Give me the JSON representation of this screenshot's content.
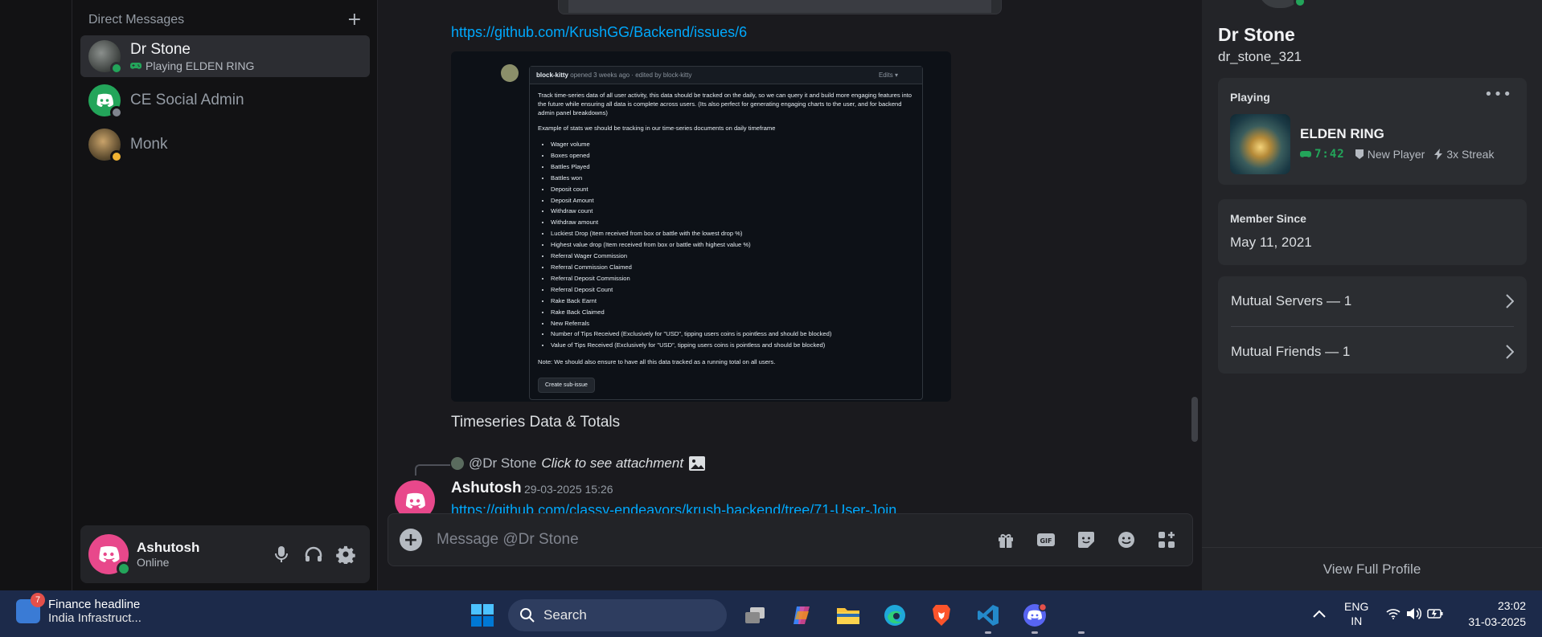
{
  "sidebar": {
    "header_label": "Direct Messages",
    "add_label": "+",
    "dms": [
      {
        "name": "Dr Stone",
        "activity": "Playing ELDEN RING"
      },
      {
        "name": "CE Social Admin",
        "activity": ""
      },
      {
        "name": "Monk",
        "activity": ""
      }
    ]
  },
  "user_panel": {
    "name": "Ashutosh",
    "status": "Online"
  },
  "chat": {
    "link1": "https://github.com/KrushGG/Backend/issues/6",
    "attachment": {
      "author": "block-kitty",
      "meta": "opened 3 weeks ago · edited by block-kitty",
      "edits": "Edits ▾",
      "intro": "Track time-series data of all user activity, this data should be tracked on the daily, so we can query it and build more engaging features into the future while ensuring all data is complete across users. (Its also perfect for generating engaging charts to the user, and for backend admin panel breakdowns)",
      "example": "Example of stats we should be tracking in our time-series documents on daily timeframe",
      "stats": [
        "Wager volume",
        "Boxes opened",
        "Battles Played",
        "Battles won",
        "Deposit count",
        "Deposit Amount",
        "Withdraw count",
        "Withdraw amount",
        "Luckiest Drop (Item received from box or battle with the lowest drop %)",
        "Highest value drop (Item received from box or battle with highest value %)",
        "Referral Wager Commission",
        "Referral Commission Claimed",
        "Referral Deposit Commission",
        "Referral Deposit Count",
        "Rake Back Earnt",
        "Rake Back Claimed",
        "New Referrals",
        "Number of Tips Received (Exclusively for \"USD\", tipping users coins is pointless and should be blocked)",
        "Value of Tips Received (Exclusively for \"USD\", tipping users coins is pointless and should be blocked)"
      ],
      "note": "Note: We should also ensure to have all this data tracked as a running total on all users.",
      "button": "Create sub-issue"
    },
    "caption": "Timeseries Data & Totals",
    "reply": {
      "mention": "@Dr Stone",
      "text": "Click to see attachment"
    },
    "message2": {
      "author": "Ashutosh",
      "timestamp": "29-03-2025 15:26",
      "link": "https://github.com/classy-endeavors/krush-backend/tree/71-User-Join"
    },
    "composer_placeholder": "Message @Dr Stone"
  },
  "profile": {
    "name": "Dr Stone",
    "handle": "dr_stone_321",
    "playing_label": "Playing",
    "more_label": "•••",
    "game": {
      "name": "ELDEN RING",
      "time": "7:42",
      "role": "New Player",
      "streak": "3x Streak"
    },
    "member_since_label": "Member Since",
    "member_since": "May 11, 2021",
    "mutual_servers": "Mutual Servers — 1",
    "mutual_friends": "Mutual Friends — 1",
    "view_full": "View Full Profile"
  },
  "taskbar": {
    "widget_badge": "7",
    "widget_title": "Finance headline",
    "widget_sub": "India Infrastruct...",
    "search_label": "Search",
    "lang_line1": "ENG",
    "lang_line2": "IN",
    "time": "23:02",
    "date": "31-03-2025"
  },
  "colors": {
    "accent": "#5865f2",
    "online": "#23a55a",
    "link": "#00a8fc",
    "avatar_pink": "#e8488b"
  }
}
